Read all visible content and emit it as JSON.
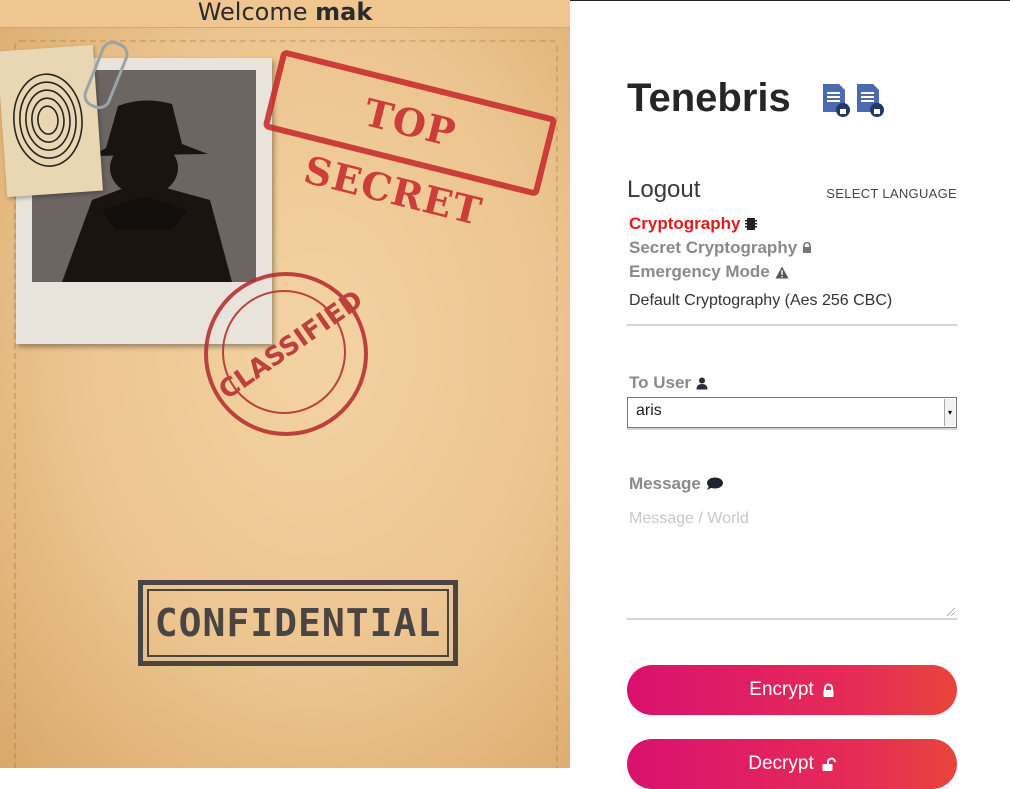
{
  "welcome": {
    "prefix": "Welcome",
    "user": "mak"
  },
  "stamps": {
    "top": "TOP SECRET",
    "classified": "CLASSIFIED",
    "confidential": "CONFIDENTIAL"
  },
  "app": {
    "title": "Tenebris"
  },
  "nav": {
    "logout": "Logout",
    "language": "SELECT LANGUAGE",
    "items": [
      {
        "label": "Cryptography",
        "icon": "chip-icon",
        "state": "active"
      },
      {
        "label": "Secret Cryptography",
        "icon": "lock-icon",
        "state": "muted"
      },
      {
        "label": "Emergency Mode",
        "icon": "warning-icon",
        "state": "muted"
      }
    ]
  },
  "form": {
    "mode_value": "Default Cryptography (Aes 256 CBC)",
    "to_user_label": "To User",
    "to_user_value": "aris",
    "message_label": "Message",
    "message_placeholder": "Message / World"
  },
  "buttons": {
    "encrypt": "Encrypt",
    "decrypt": "Decrypt"
  },
  "colors": {
    "accent_red": "#e31b1b",
    "button_start": "#d9116f",
    "button_end": "#e8453c"
  }
}
